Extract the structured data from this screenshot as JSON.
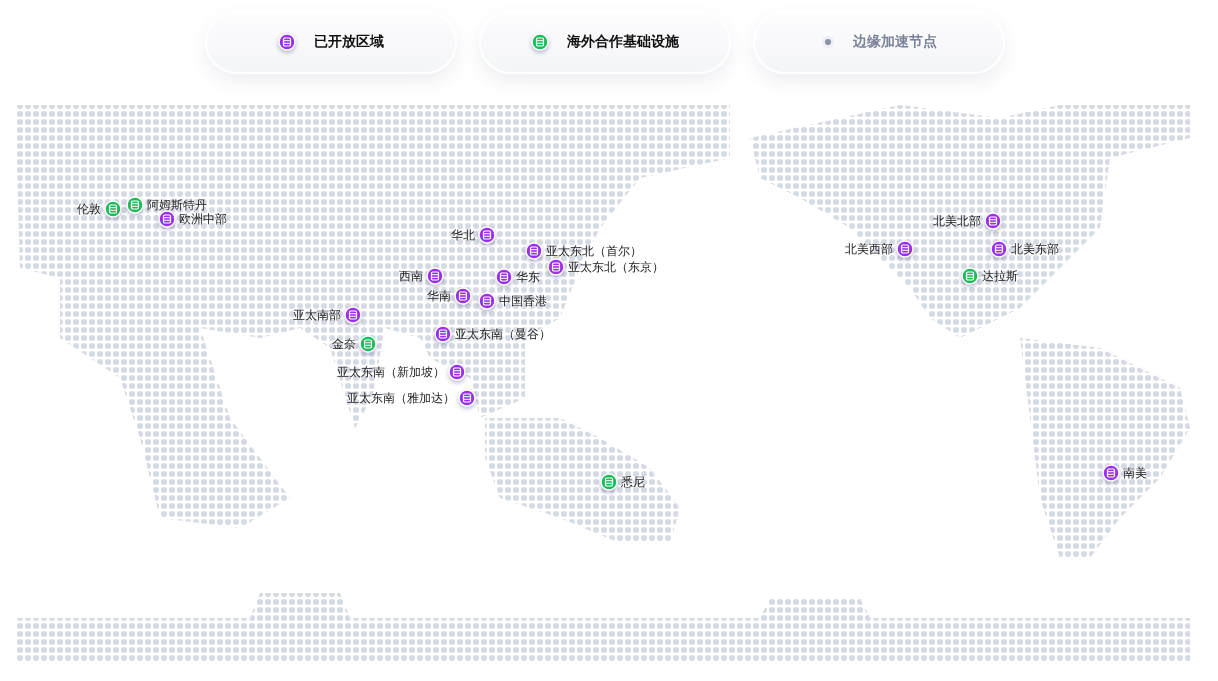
{
  "legend": [
    {
      "kind": "region",
      "label": "已开放区域",
      "active": true
    },
    {
      "kind": "partner",
      "label": "海外合作基础设施",
      "active": true
    },
    {
      "kind": "edge",
      "label": "边缘加速节点",
      "active": false
    }
  ],
  "pins": [
    {
      "kind": "partner",
      "label": "伦敦"
    },
    {
      "kind": "partner",
      "label": "阿姆斯特丹"
    },
    {
      "kind": "region",
      "label": "欧洲中部"
    },
    {
      "kind": "region",
      "label": "华北"
    },
    {
      "kind": "region",
      "label": "亚太东北（首尔）"
    },
    {
      "kind": "region",
      "label": "亚太东北（东京）"
    },
    {
      "kind": "region",
      "label": "西南"
    },
    {
      "kind": "region",
      "label": "华东"
    },
    {
      "kind": "region",
      "label": "华南"
    },
    {
      "kind": "region",
      "label": "中国香港"
    },
    {
      "kind": "region",
      "label": "亚太南部"
    },
    {
      "kind": "region",
      "label": "亚太东南（曼谷）"
    },
    {
      "kind": "partner",
      "label": "金奈"
    },
    {
      "kind": "region",
      "label": "亚太东南（新加坡）"
    },
    {
      "kind": "region",
      "label": "亚太东南（雅加达）"
    },
    {
      "kind": "partner",
      "label": "悉尼"
    },
    {
      "kind": "region",
      "label": "北美北部"
    },
    {
      "kind": "region",
      "label": "北美西部"
    },
    {
      "kind": "region",
      "label": "北美东部"
    },
    {
      "kind": "partner",
      "label": "达拉斯"
    },
    {
      "kind": "region",
      "label": "南美"
    }
  ]
}
